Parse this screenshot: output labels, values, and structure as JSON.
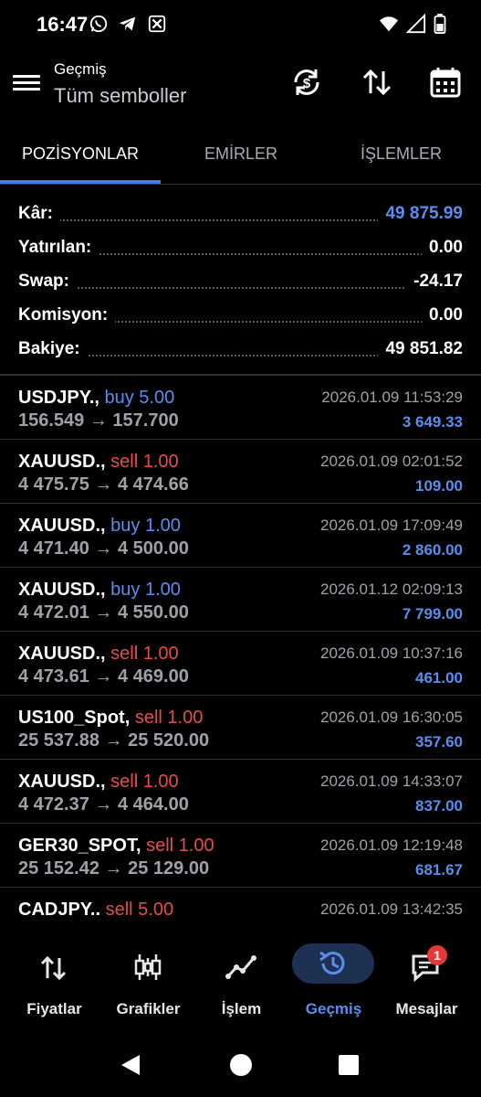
{
  "status_bar": {
    "time": "16:47",
    "left_icons": [
      "whatsapp-icon",
      "telegram-icon",
      "app-icon"
    ],
    "right_icons": [
      "wifi-icon",
      "signal-icon",
      "battery-icon"
    ]
  },
  "app_bar": {
    "title": "Geçmiş",
    "subtitle": "Tüm semboller",
    "actions": [
      "dollar-refresh-icon",
      "sort-icon",
      "calendar-icon"
    ]
  },
  "tabs": [
    {
      "label": "POZİSYONLAR",
      "active": true
    },
    {
      "label": "EMİRLER",
      "active": false
    },
    {
      "label": "İŞLEMLER",
      "active": false
    }
  ],
  "summary": [
    {
      "label": "Kâr:",
      "value": "49 875.99",
      "color": "#5b8def"
    },
    {
      "label": "Yatırılan:",
      "value": "0.00"
    },
    {
      "label": "Swap:",
      "value": "-24.17"
    },
    {
      "label": "Komisyon:",
      "value": "0.00"
    },
    {
      "label": "Bakiye:",
      "value": "49 851.82"
    }
  ],
  "trades": [
    {
      "symbol": "USDJPY.,",
      "side": "buy 5.00",
      "type": "buy",
      "prices": "156.549 → 157.700",
      "date": "2026.01.09 11:53:29",
      "profit": "3 649.33"
    },
    {
      "symbol": "XAUUSD.,",
      "side": "sell 1.00",
      "type": "sell",
      "prices": "4 475.75 → 4 474.66",
      "date": "2026.01.09 02:01:52",
      "profit": "109.00"
    },
    {
      "symbol": "XAUUSD.,",
      "side": "buy 1.00",
      "type": "buy",
      "prices": "4 471.40 → 4 500.00",
      "date": "2026.01.09 17:09:49",
      "profit": "2 860.00"
    },
    {
      "symbol": "XAUUSD.,",
      "side": "buy 1.00",
      "type": "buy",
      "prices": "4 472.01 → 4 550.00",
      "date": "2026.01.12 02:09:13",
      "profit": "7 799.00"
    },
    {
      "symbol": "XAUUSD.,",
      "side": "sell 1.00",
      "type": "sell",
      "prices": "4 473.61 → 4 469.00",
      "date": "2026.01.09 10:37:16",
      "profit": "461.00"
    },
    {
      "symbol": "US100_Spot,",
      "side": "sell 1.00",
      "type": "sell",
      "prices": "25 537.88 → 25 520.00",
      "date": "2026.01.09 16:30:05",
      "profit": "357.60"
    },
    {
      "symbol": "XAUUSD.,",
      "side": "sell 1.00",
      "type": "sell",
      "prices": "4 472.37 → 4 464.00",
      "date": "2026.01.09 14:33:07",
      "profit": "837.00"
    },
    {
      "symbol": "GER30_SPOT,",
      "side": "sell 1.00",
      "type": "sell",
      "prices": "25 152.42 → 25 129.00",
      "date": "2026.01.09 12:19:48",
      "profit": "681.67"
    },
    {
      "symbol": "CADJPY..",
      "side": "sell 5.00",
      "type": "sell",
      "prices": "",
      "date": "2026.01.09 13:42:35",
      "profit": ""
    }
  ],
  "bottom_nav": [
    {
      "label": "Fiyatlar",
      "icon": "quotes-icon",
      "active": false
    },
    {
      "label": "Grafikler",
      "icon": "chart-icon",
      "active": false
    },
    {
      "label": "İşlem",
      "icon": "trade-icon",
      "active": false
    },
    {
      "label": "Geçmiş",
      "icon": "history-icon",
      "active": true
    },
    {
      "label": "Mesajlar",
      "icon": "messages-icon",
      "active": false,
      "badge": "1"
    }
  ],
  "colors": {
    "accent": "#5b8def",
    "sell": "#e84b4b",
    "tab_underline": "#3e7fe6"
  }
}
